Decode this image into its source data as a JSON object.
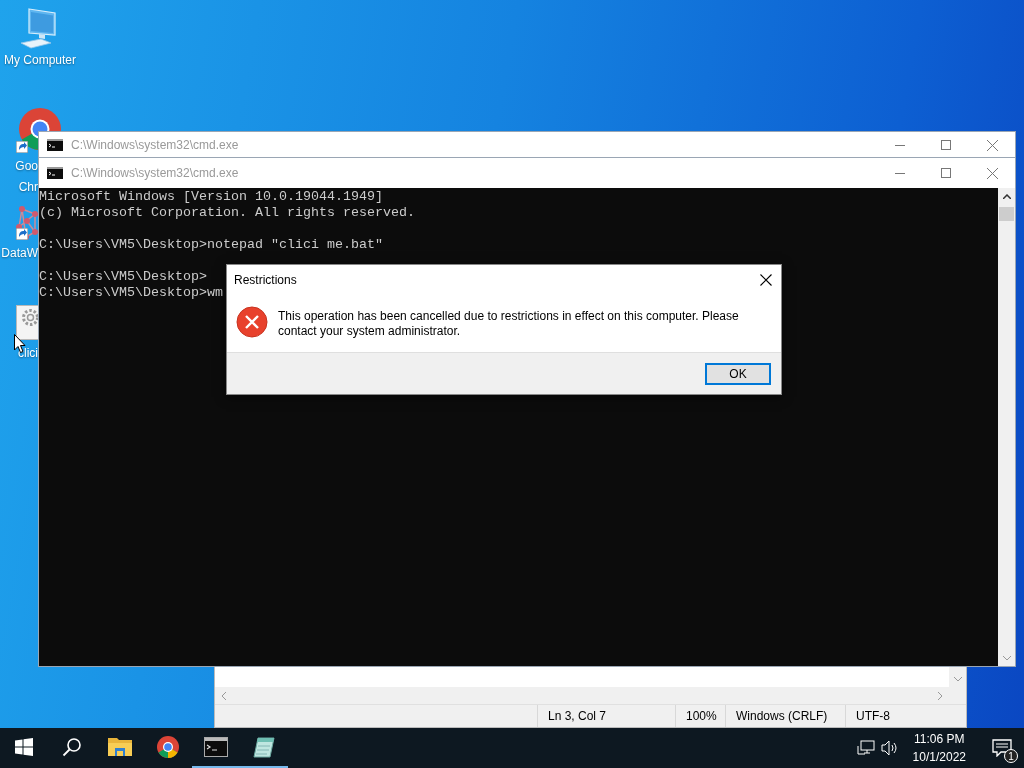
{
  "desktop_icons": [
    {
      "kind": "computer",
      "lines": [
        "My Computer"
      ],
      "shortcut": false,
      "clipped": false
    },
    {
      "kind": "chrome",
      "lines": [
        "Goo",
        "Chr"
      ],
      "shortcut": true,
      "clipped": true
    },
    {
      "kind": "app",
      "lines": [
        "DataW"
      ],
      "shortcut": true,
      "clipped": true
    },
    {
      "kind": "file",
      "lines": [
        "clici"
      ],
      "shortcut": false,
      "clipped": true
    }
  ],
  "windows": [
    {
      "kind": "console",
      "title": "C:\\Windows\\system32\\cmd.exe",
      "active": false
    },
    {
      "kind": "console",
      "title": "C:\\Windows\\system32\\cmd.exe",
      "active": false,
      "console_blocks": [
        [
          "Microsoft Windows [Version 10.0.19044.1949]",
          "(c) Microsoft Corporation. All rights reserved."
        ],
        [
          "C:\\Users\\VM5\\Desktop>notepad \"clici me.bat\""
        ],
        [
          "C:\\Users\\VM5\\Desktop>",
          "C:\\Users\\VM5\\Desktop>wm"
        ]
      ]
    }
  ],
  "notepad_status_bar": [
    "Ln 3, Col 7",
    "100%",
    "Windows (CRLF)",
    "UTF-8"
  ],
  "dialog": {
    "title": "Restrictions",
    "message": "This operation has been cancelled due to restrictions in effect on this computer. Please contact your system administrator.",
    "buttons": [
      {
        "label": "OK",
        "default": true
      }
    ]
  },
  "taskbar": {
    "items": [
      {
        "kind": "start",
        "running": false
      },
      {
        "kind": "search",
        "running": false
      },
      {
        "kind": "explorer",
        "running": false
      },
      {
        "kind": "chrome",
        "running": false
      },
      {
        "kind": "console",
        "running": true
      },
      {
        "kind": "notepad",
        "running": true
      }
    ],
    "time": "11:06 PM",
    "date": "10/1/2022",
    "notification_count": "1"
  }
}
